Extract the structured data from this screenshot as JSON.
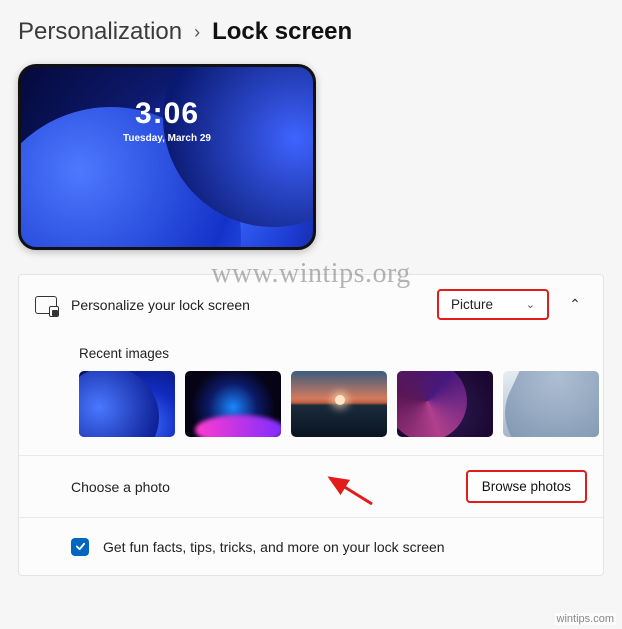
{
  "breadcrumb": {
    "parent": "Personalization",
    "separator": "›",
    "current": "Lock screen"
  },
  "preview": {
    "time": "3:06",
    "date": "Tuesday, March 29"
  },
  "personalize_row": {
    "label": "Personalize your lock screen",
    "dropdown_value": "Picture"
  },
  "recent": {
    "label": "Recent images",
    "thumbs": [
      {
        "name": "default-bloom-blue"
      },
      {
        "name": "glow-sphere-dark"
      },
      {
        "name": "sunset-horizon"
      },
      {
        "name": "purple-swirl"
      },
      {
        "name": "light-grey-waves"
      }
    ]
  },
  "choose_photo": {
    "label": "Choose a photo",
    "button": "Browse photos"
  },
  "fun_facts": {
    "checked": true,
    "label": "Get fun facts, tips, tricks, and more on your lock screen"
  },
  "watermark": "www.wintips.org",
  "source_caption": "wintips.com",
  "colors": {
    "highlight_border": "#e21b1b",
    "accent": "#0067c0"
  }
}
